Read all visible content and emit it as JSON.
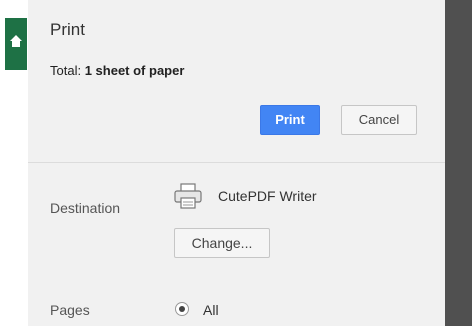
{
  "dialog": {
    "title": "Print",
    "total_label": "Total:",
    "total_value": "1 sheet of paper",
    "print_button": "Print",
    "cancel_button": "Cancel"
  },
  "destination": {
    "label": "Destination",
    "printer_name": "CutePDF Writer",
    "printer_icon": "printer-icon",
    "change_button": "Change..."
  },
  "pages": {
    "label": "Pages",
    "selected_option": "All"
  },
  "colors": {
    "accent": "#4285f4",
    "home_tab": "#1e7145",
    "panel_bg": "#f1f1f1"
  }
}
